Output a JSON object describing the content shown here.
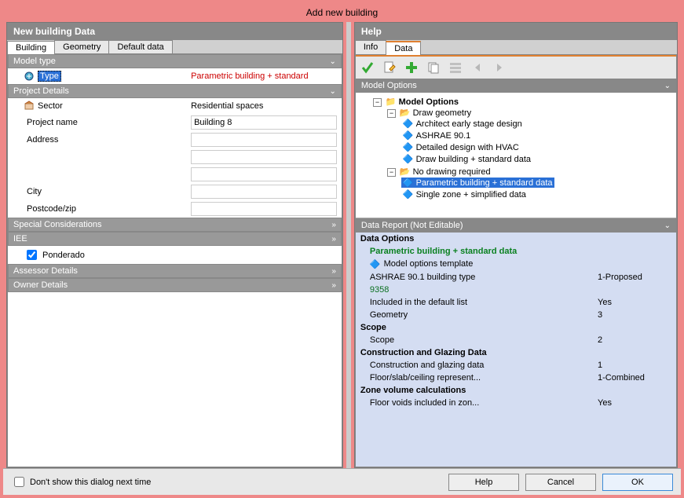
{
  "window": {
    "title": "Add new building"
  },
  "left": {
    "title": "New building Data",
    "tabs": {
      "building": "Building",
      "geometry": "Geometry",
      "default": "Default data"
    },
    "sections": {
      "model_type": {
        "title": "Model type"
      },
      "project_details": {
        "title": "Project Details"
      },
      "special": {
        "title": "Special Considerations"
      },
      "iee": {
        "title": "IEE"
      },
      "assessor": {
        "title": "Assessor Details"
      },
      "owner": {
        "title": "Owner Details"
      }
    },
    "fields": {
      "type_label": "Type",
      "type_value": "Parametric building + standard",
      "sector_label": "Sector",
      "sector_value": "Residential spaces",
      "projectname_label": "Project name",
      "projectname_value": "Building 8",
      "address_label": "Address",
      "city_label": "City",
      "postcode_label": "Postcode/zip",
      "ponderado_label": "Ponderado"
    }
  },
  "right": {
    "title": "Help",
    "tabs": {
      "info": "Info",
      "data": "Data"
    },
    "model_options_hdr": "Model Options",
    "tree": {
      "root": "Model Options",
      "draw_geom": "Draw geometry",
      "arch": "Architect early stage design",
      "ashrae": "ASHRAE 90.1",
      "detailed": "Detailed design with HVAC",
      "draw_std": "Draw building + standard data",
      "no_draw": "No drawing required",
      "param_std": "Parametric building + standard data",
      "single": "Single zone + simplified data"
    },
    "report_hdr": "Data Report (Not Editable)",
    "report": {
      "data_options": "Data Options",
      "title_green": "Parametric building + standard data",
      "template": "Model options template",
      "ashrae_type_k": "ASHRAE 90.1 building type",
      "ashrae_type_v": "1-Proposed",
      "id": "9358",
      "included_k": "Included in the default list",
      "included_v": "Yes",
      "geom_k": "Geometry",
      "geom_v": "3",
      "scope_h": "Scope",
      "scope_k": "Scope",
      "scope_v": "2",
      "constr_h": "Construction and Glazing Data",
      "constr_k": "Construction and glazing data",
      "constr_v": "1",
      "floor_k": "Floor/slab/ceiling represent...",
      "floor_v": "1-Combined",
      "zone_h": "Zone volume calculations",
      "voids_k": "Floor voids included in zon...",
      "voids_v": "Yes"
    }
  },
  "footer": {
    "dont_show": "Don't show this dialog next time",
    "help": "Help",
    "cancel": "Cancel",
    "ok": "OK"
  }
}
